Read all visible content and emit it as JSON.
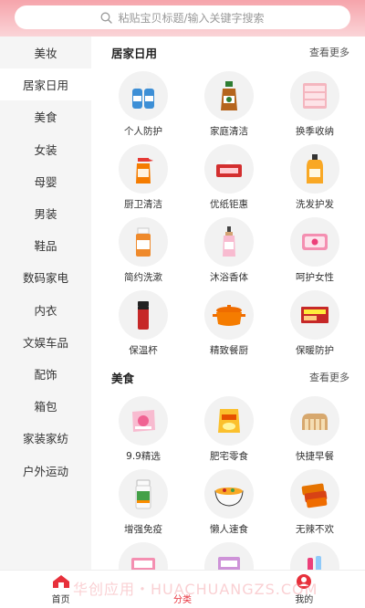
{
  "search": {
    "placeholder": "粘贴宝贝标题/输入关键字搜索"
  },
  "sidebar": {
    "items": [
      {
        "label": "美妆"
      },
      {
        "label": "居家日用"
      },
      {
        "label": "美食"
      },
      {
        "label": "女装"
      },
      {
        "label": "母婴"
      },
      {
        "label": "男装"
      },
      {
        "label": "鞋品"
      },
      {
        "label": "数码家电"
      },
      {
        "label": "内衣"
      },
      {
        "label": "文娱车品"
      },
      {
        "label": "配饰"
      },
      {
        "label": "箱包"
      },
      {
        "label": "家装家纺"
      },
      {
        "label": "户外运动"
      }
    ],
    "active_index": 1
  },
  "sections": [
    {
      "title": "居家日用",
      "more": "查看更多",
      "items": [
        {
          "label": "个人防护",
          "icon": "hand-sanitizer-icon"
        },
        {
          "label": "家庭清洁",
          "icon": "disinfectant-bottle-icon"
        },
        {
          "label": "换季收纳",
          "icon": "storage-drawers-icon"
        },
        {
          "label": "厨卫清洁",
          "icon": "spray-bottle-icon"
        },
        {
          "label": "优纸钜惠",
          "icon": "tissue-box-icon"
        },
        {
          "label": "洗发护发",
          "icon": "shampoo-bottle-icon"
        },
        {
          "label": "简约洗漱",
          "icon": "mouthwash-bottle-icon"
        },
        {
          "label": "沐浴香体",
          "icon": "body-wash-bottle-icon"
        },
        {
          "label": "呵护女性",
          "icon": "sanitary-pad-icon"
        },
        {
          "label": "保温杯",
          "icon": "thermos-cup-icon"
        },
        {
          "label": "精致餐厨",
          "icon": "cooking-pot-icon"
        },
        {
          "label": "保暖防护",
          "icon": "heat-patch-icon"
        }
      ]
    },
    {
      "title": "美食",
      "more": "查看更多",
      "items": [
        {
          "label": "9.9精选",
          "icon": "snack-bag-icon"
        },
        {
          "label": "肥宅零食",
          "icon": "chips-bag-icon"
        },
        {
          "label": "快捷早餐",
          "icon": "bread-loaf-icon"
        },
        {
          "label": "增强免疫",
          "icon": "supplement-jar-icon"
        },
        {
          "label": "懒人速食",
          "icon": "noodle-bowl-icon"
        },
        {
          "label": "无辣不欢",
          "icon": "spicy-strips-icon"
        },
        {
          "label": "",
          "icon": "snack-box-icon"
        },
        {
          "label": "",
          "icon": "snack-pack-icon"
        },
        {
          "label": "",
          "icon": "drink-bottles-icon"
        }
      ]
    }
  ],
  "bottom_nav": {
    "items": [
      {
        "label": "首页",
        "icon": "home-icon"
      },
      {
        "label": "分类",
        "icon": "category-icon"
      },
      {
        "label": "我的",
        "icon": "profile-icon"
      }
    ],
    "active_index": 1
  },
  "watermark": "华创应用・HUACHUANGZS.COM",
  "colors": {
    "accent": "#e7303b",
    "header_pink": "#f6a4ab",
    "sidebar_bg": "#f5f5f5"
  }
}
